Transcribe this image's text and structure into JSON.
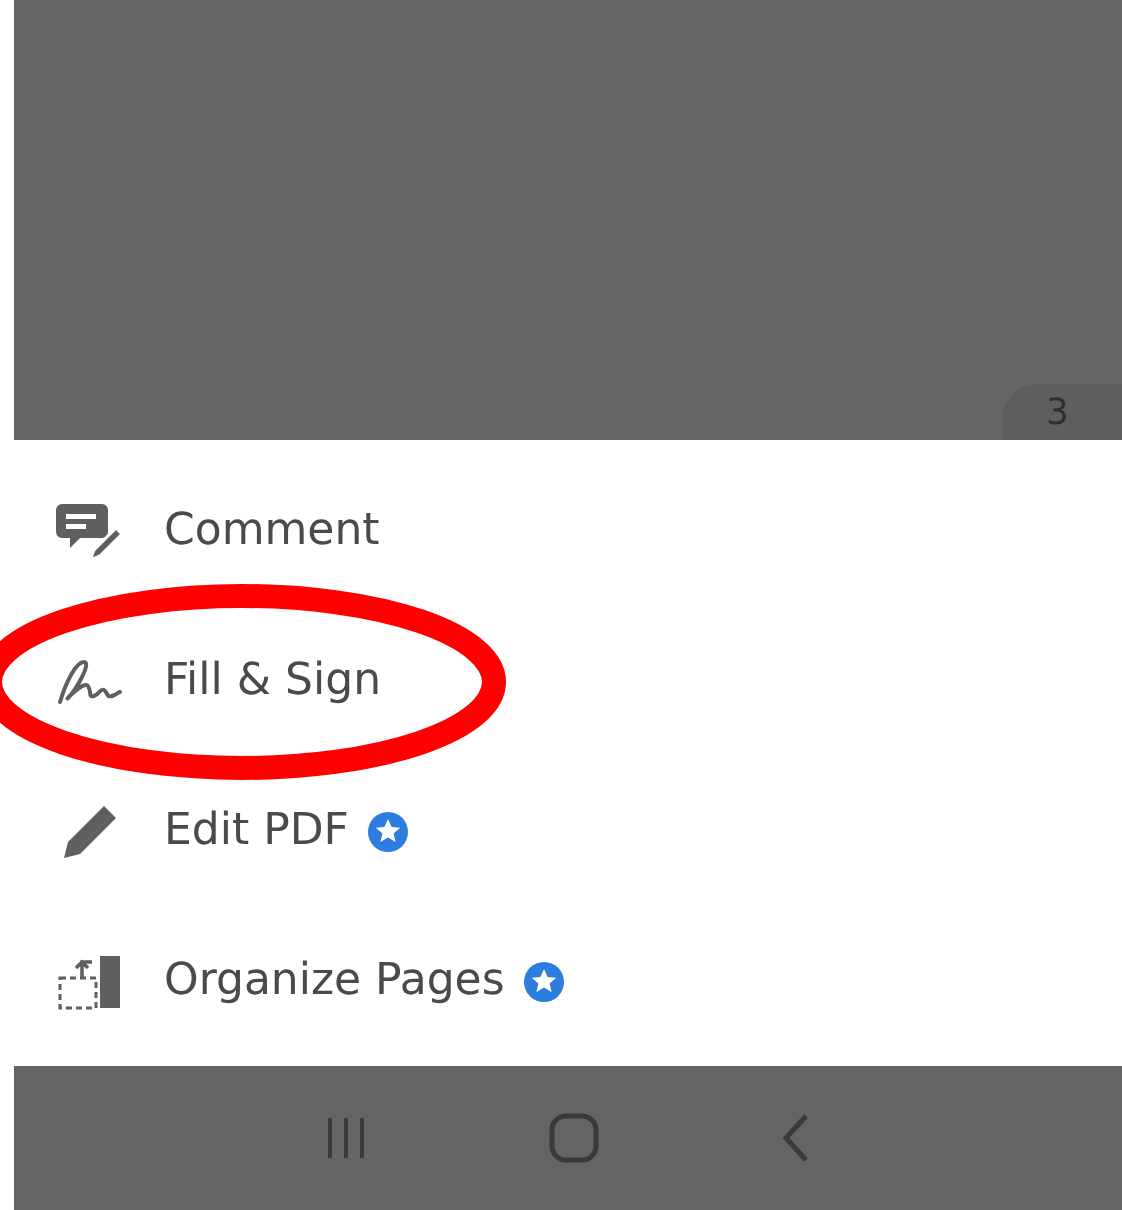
{
  "document_view": {
    "page_number": "3"
  },
  "menu": [
    {
      "label": "Comment",
      "kind": "comment",
      "premium": false,
      "circled": false
    },
    {
      "label": "Fill & Sign",
      "kind": "fill-sign",
      "premium": false,
      "circled": true
    },
    {
      "label": "Edit PDF",
      "kind": "edit",
      "premium": true,
      "circled": false
    },
    {
      "label": "Organize Pages",
      "kind": "organize",
      "premium": true,
      "circled": false
    }
  ]
}
